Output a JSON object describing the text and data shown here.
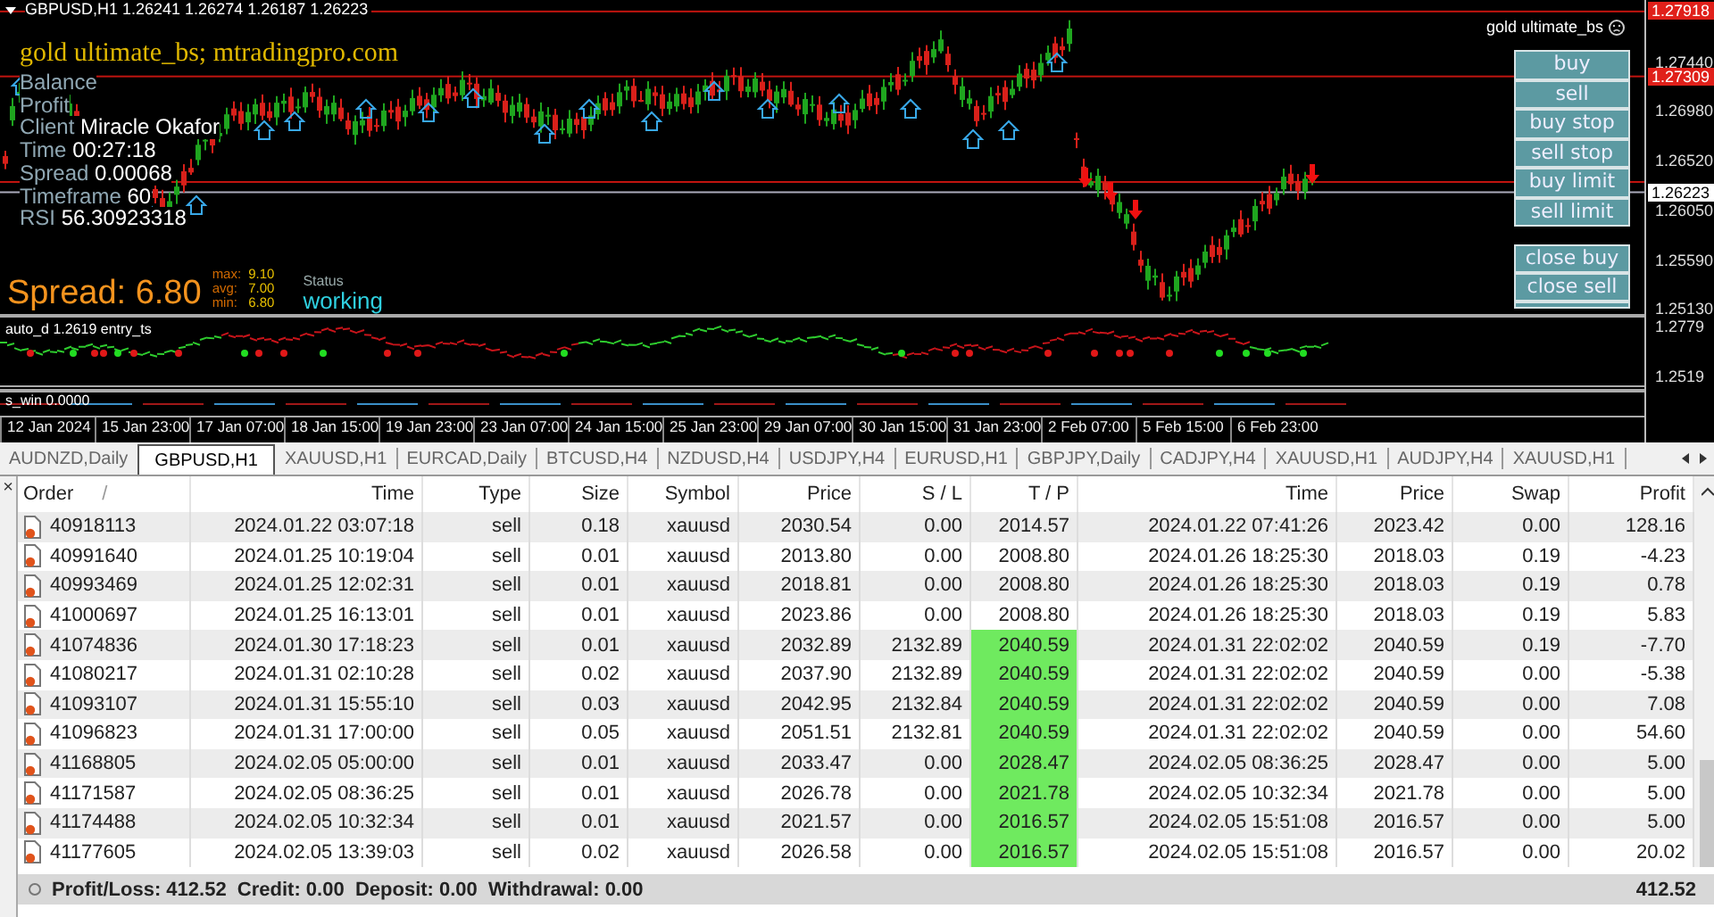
{
  "chart": {
    "header": "GBPUSD,H1  1.26241 1.26274 1.26187 1.26223",
    "expert_name": "gold ultimate_bs",
    "watermark": "gold ultimate_bs; mtradingpro.com",
    "info": [
      {
        "label": "Balance"
      },
      {
        "label": "Profit"
      },
      {
        "label": "Client",
        "value": "Miracle Okafor"
      },
      {
        "label": "Time",
        "value": "00:27:18"
      },
      {
        "label": "Spread",
        "value": "0.00068"
      },
      {
        "label": "Timeframe",
        "value": "60"
      },
      {
        "label": "RSI",
        "value": "56.30923318"
      }
    ],
    "spread_panel": {
      "spread": "Spread: 6.80",
      "stats": [
        {
          "label": "max:",
          "value": "9.10"
        },
        {
          "label": "avg:",
          "value": "7.00"
        },
        {
          "label": "min:",
          "value": "6.80"
        }
      ],
      "status_label": "Status",
      "status": "working"
    },
    "price_ticks": [
      "1.27440",
      "1.26980",
      "1.26520",
      "1.26050",
      "1.25590",
      "1.25130"
    ],
    "price_levels": [
      {
        "label": "1.27918",
        "kind": "line"
      },
      {
        "label": "1.27309",
        "kind": "line"
      },
      {
        "label": "1.26223",
        "kind": "current"
      }
    ],
    "trade_buttons": [
      "buy",
      "sell",
      "buy stop",
      "sell stop",
      "buy limit",
      "sell limit"
    ],
    "close_buttons": [
      "close buy",
      "close sell"
    ],
    "indicator_1": {
      "label": "auto_d 1.2619  entry_ts",
      "ticks": [
        "1.2779",
        "1.2519"
      ]
    },
    "indicator_2": {
      "label": "s_win 0.0000"
    },
    "time_axis": [
      "12 Jan 2024",
      "15 Jan 23:00",
      "17 Jan 07:00",
      "18 Jan 15:00",
      "19 Jan 23:00",
      "23 Jan 07:00",
      "24 Jan 15:00",
      "25 Jan 23:00",
      "29 Jan 07:00",
      "30 Jan 15:00",
      "31 Jan 23:00",
      "2 Feb 07:00",
      "5 Feb 15:00",
      "6 Feb 23:00"
    ]
  },
  "tabs": [
    {
      "label": "AUDNZD,Daily",
      "selected": false
    },
    {
      "label": "GBPUSD,H1",
      "selected": true
    },
    {
      "label": "XAUUSD,H1",
      "selected": false
    },
    {
      "label": "EURCAD,Daily",
      "selected": false
    },
    {
      "label": "BTCUSD,H4",
      "selected": false
    },
    {
      "label": "NZDUSD,H4",
      "selected": false
    },
    {
      "label": "USDJPY,H4",
      "selected": false
    },
    {
      "label": "EURUSD,H1",
      "selected": false
    },
    {
      "label": "GBPJPY,Daily",
      "selected": false
    },
    {
      "label": "CADJPY,H4",
      "selected": false
    },
    {
      "label": "XAUUSD,H1",
      "selected": false
    },
    {
      "label": "AUDJPY,H4",
      "selected": false
    },
    {
      "label": "XAUUSD,H1",
      "selected": false
    }
  ],
  "terminal": {
    "close": "×"
  },
  "table": {
    "columns": [
      "Order",
      "Time",
      "Type",
      "Size",
      "Symbol",
      "Price",
      "S / L",
      "T / P",
      "Time",
      "Price",
      "Swap",
      "Profit"
    ],
    "sort_mark": "/",
    "rows": [
      {
        "cells": [
          "40918113",
          "2024.01.22 03:07:18",
          "sell",
          "0.18",
          "xauusd",
          "2030.54",
          "0.00",
          "2014.57",
          "2024.01.22 07:41:26",
          "2023.42",
          "0.00",
          "128.16"
        ],
        "tp_hit": false
      },
      {
        "cells": [
          "40991640",
          "2024.01.25 10:19:04",
          "sell",
          "0.01",
          "xauusd",
          "2013.80",
          "0.00",
          "2008.80",
          "2024.01.26 18:25:30",
          "2018.03",
          "0.19",
          "-4.23"
        ],
        "tp_hit": false
      },
      {
        "cells": [
          "40993469",
          "2024.01.25 12:02:31",
          "sell",
          "0.01",
          "xauusd",
          "2018.81",
          "0.00",
          "2008.80",
          "2024.01.26 18:25:30",
          "2018.03",
          "0.19",
          "0.78"
        ],
        "tp_hit": false
      },
      {
        "cells": [
          "41000697",
          "2024.01.25 16:13:01",
          "sell",
          "0.01",
          "xauusd",
          "2023.86",
          "0.00",
          "2008.80",
          "2024.01.26 18:25:30",
          "2018.03",
          "0.19",
          "5.83"
        ],
        "tp_hit": false
      },
      {
        "cells": [
          "41074836",
          "2024.01.30 17:18:23",
          "sell",
          "0.01",
          "xauusd",
          "2032.89",
          "2132.89",
          "2040.59",
          "2024.01.31 22:02:02",
          "2040.59",
          "0.19",
          "-7.70"
        ],
        "tp_hit": true
      },
      {
        "cells": [
          "41080217",
          "2024.01.31 02:10:28",
          "sell",
          "0.02",
          "xauusd",
          "2037.90",
          "2132.89",
          "2040.59",
          "2024.01.31 22:02:02",
          "2040.59",
          "0.00",
          "-5.38"
        ],
        "tp_hit": true
      },
      {
        "cells": [
          "41093107",
          "2024.01.31 15:55:10",
          "sell",
          "0.03",
          "xauusd",
          "2042.95",
          "2132.84",
          "2040.59",
          "2024.01.31 22:02:02",
          "2040.59",
          "0.00",
          "7.08"
        ],
        "tp_hit": true
      },
      {
        "cells": [
          "41096823",
          "2024.01.31 17:00:00",
          "sell",
          "0.05",
          "xauusd",
          "2051.51",
          "2132.81",
          "2040.59",
          "2024.01.31 22:02:02",
          "2040.59",
          "0.00",
          "54.60"
        ],
        "tp_hit": true
      },
      {
        "cells": [
          "41168805",
          "2024.02.05 05:00:00",
          "sell",
          "0.01",
          "xauusd",
          "2033.47",
          "0.00",
          "2028.47",
          "2024.02.05 08:36:25",
          "2028.47",
          "0.00",
          "5.00"
        ],
        "tp_hit": true
      },
      {
        "cells": [
          "41171587",
          "2024.02.05 08:36:25",
          "sell",
          "0.01",
          "xauusd",
          "2026.78",
          "0.00",
          "2021.78",
          "2024.02.05 10:32:34",
          "2021.78",
          "0.00",
          "5.00"
        ],
        "tp_hit": true
      },
      {
        "cells": [
          "41174488",
          "2024.02.05 10:32:34",
          "sell",
          "0.01",
          "xauusd",
          "2021.57",
          "0.00",
          "2016.57",
          "2024.02.05 15:51:08",
          "2016.57",
          "0.00",
          "5.00"
        ],
        "tp_hit": true
      },
      {
        "cells": [
          "41177605",
          "2024.02.05 13:39:03",
          "sell",
          "0.02",
          "xauusd",
          "2026.58",
          "0.00",
          "2016.57",
          "2024.02.05 15:51:08",
          "2016.57",
          "0.00",
          "20.02"
        ],
        "tp_hit": true
      }
    ]
  },
  "status_bar": {
    "summary": "Profit/Loss: 412.52  Credit: 0.00  Deposit: 0.00  Withdrawal: 0.00",
    "total": "412.52"
  }
}
